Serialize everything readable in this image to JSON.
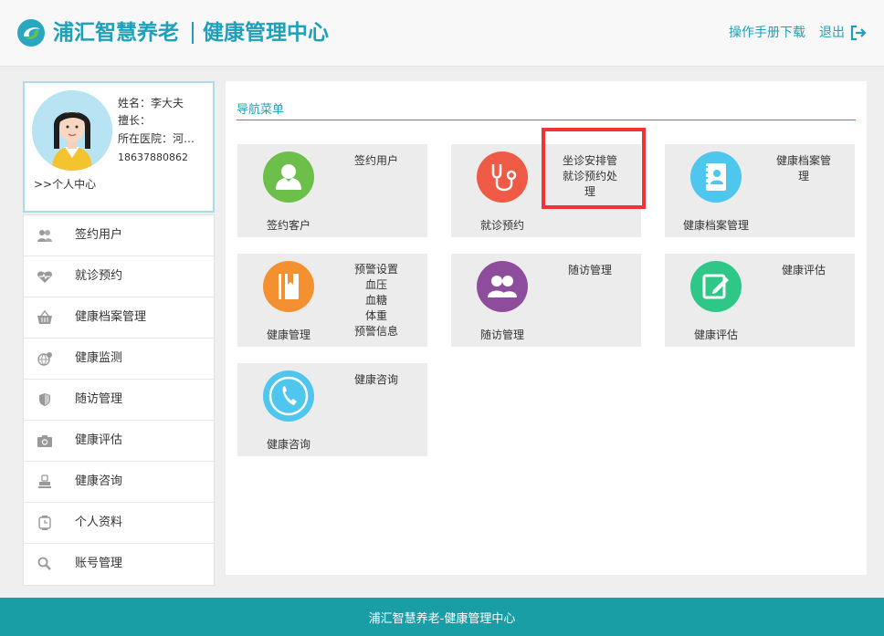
{
  "header": {
    "brand": "浦汇智慧养老",
    "subtitle": "健康管理中心",
    "manual_link": "操作手册下载",
    "logout_link": "退出"
  },
  "profile": {
    "name": "姓名：李大夫",
    "specialty": "擅长：",
    "hospital": "所在医院：河…",
    "phone": "18637880862",
    "center_link": ">>个人中心"
  },
  "sidebar": {
    "items": [
      {
        "label": "签约用户",
        "icon": "users-icon"
      },
      {
        "label": "就诊预约",
        "icon": "heart-pulse-icon"
      },
      {
        "label": "健康档案管理",
        "icon": "basket-icon"
      },
      {
        "label": "健康监测",
        "icon": "globe-icon"
      },
      {
        "label": "随访管理",
        "icon": "shield-icon"
      },
      {
        "label": "健康评估",
        "icon": "camera-icon"
      },
      {
        "label": "健康咨询",
        "icon": "stamp-icon"
      },
      {
        "label": "个人资料",
        "icon": "watch-icon"
      },
      {
        "label": "账号管理",
        "icon": "search-icon"
      }
    ]
  },
  "main": {
    "nav_title": "导航菜单",
    "tiles": [
      {
        "bottom": "签约客户",
        "right": [
          "签约用户"
        ],
        "color": "#6cc04a",
        "icon": "user-icon"
      },
      {
        "bottom": "就诊预约",
        "right": [
          "坐诊安排管",
          "就诊预约处",
          "理"
        ],
        "color": "#ee5a45",
        "icon": "stethoscope-icon"
      },
      {
        "bottom": "健康档案管理",
        "right": [
          "健康档案管",
          "理"
        ],
        "color": "#4fc6ee",
        "icon": "address-book-icon"
      },
      {
        "bottom": "健康管理",
        "right": [
          "预警设置",
          "血压",
          "血糖",
          "体重",
          "预警信息"
        ],
        "color": "#f59030",
        "icon": "book-icon"
      },
      {
        "bottom": "随访管理",
        "right": [
          "随访管理"
        ],
        "color": "#8e4d9c",
        "icon": "group-icon"
      },
      {
        "bottom": "健康评估",
        "right": [
          "健康评估"
        ],
        "color": "#2ec788",
        "icon": "edit-icon"
      },
      {
        "bottom": "健康咨询",
        "right": [
          "健康咨询"
        ],
        "color": "#4fc6ee",
        "icon": "phone-icon"
      }
    ]
  },
  "footer": {
    "text": "浦汇智慧养老-健康管理中心"
  }
}
